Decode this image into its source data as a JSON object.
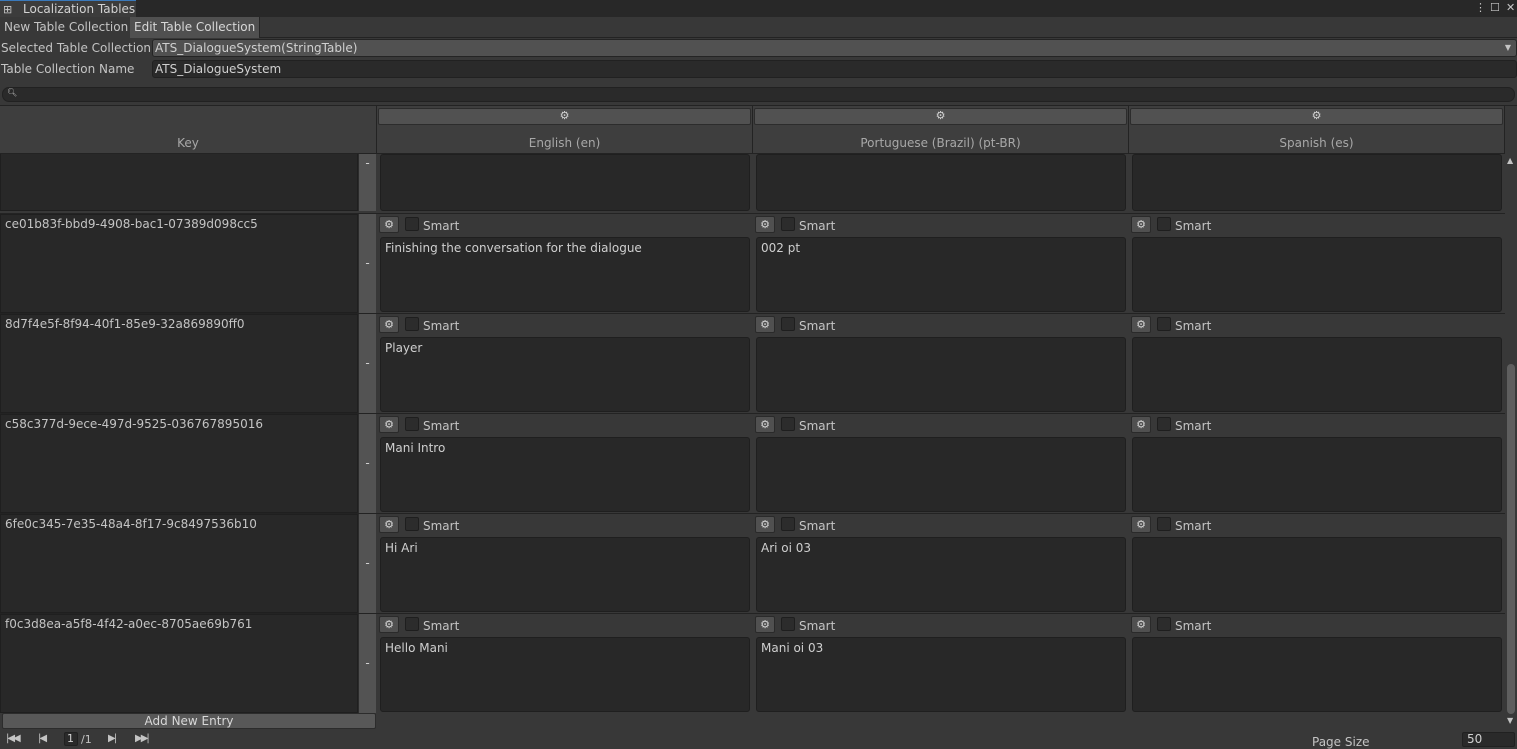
{
  "window": {
    "title": "Localization Tables"
  },
  "toolbar": {
    "new_tab": "New Table Collection",
    "edit_tab": "Edit Table Collection"
  },
  "fields": {
    "selected_label": "Selected Table Collection",
    "selected_value": "ATS_DialogueSystem(StringTable)",
    "name_label": "Table Collection Name",
    "name_value": "ATS_DialogueSystem"
  },
  "search": {
    "placeholder": ""
  },
  "table": {
    "key_header": "Key",
    "columns": [
      "English (en)",
      "Portuguese (Brazil) (pt-BR)",
      "Spanish (es)"
    ],
    "smart_label": "Smart",
    "remove_label": "-",
    "rows": [
      {
        "key": "ce01b83f-bbd9-4908-bac1-07389d098cc5",
        "values": [
          "Finishing the conversation for the dialogue",
          "002 pt",
          ""
        ]
      },
      {
        "key": "8d7f4e5f-8f94-40f1-85e9-32a869890ff0",
        "values": [
          "Player",
          "",
          ""
        ]
      },
      {
        "key": "c58c377d-9ece-497d-9525-036767895016",
        "values": [
          "Mani Intro",
          "",
          ""
        ]
      },
      {
        "key": "6fe0c345-7e35-48a4-8f17-9c8497536b10",
        "values": [
          "Hi Ari",
          "Ari oi 03",
          ""
        ]
      },
      {
        "key": "f0c3d8ea-a5f8-4f42-a0ec-8705ae69b761",
        "values": [
          "Hello Mani",
          "Mani oi 03",
          ""
        ]
      }
    ]
  },
  "footer": {
    "add_entry": "Add New Entry",
    "page_current": "1",
    "page_total": "/1",
    "page_size_label": "Page Size",
    "page_size_value": "50"
  }
}
